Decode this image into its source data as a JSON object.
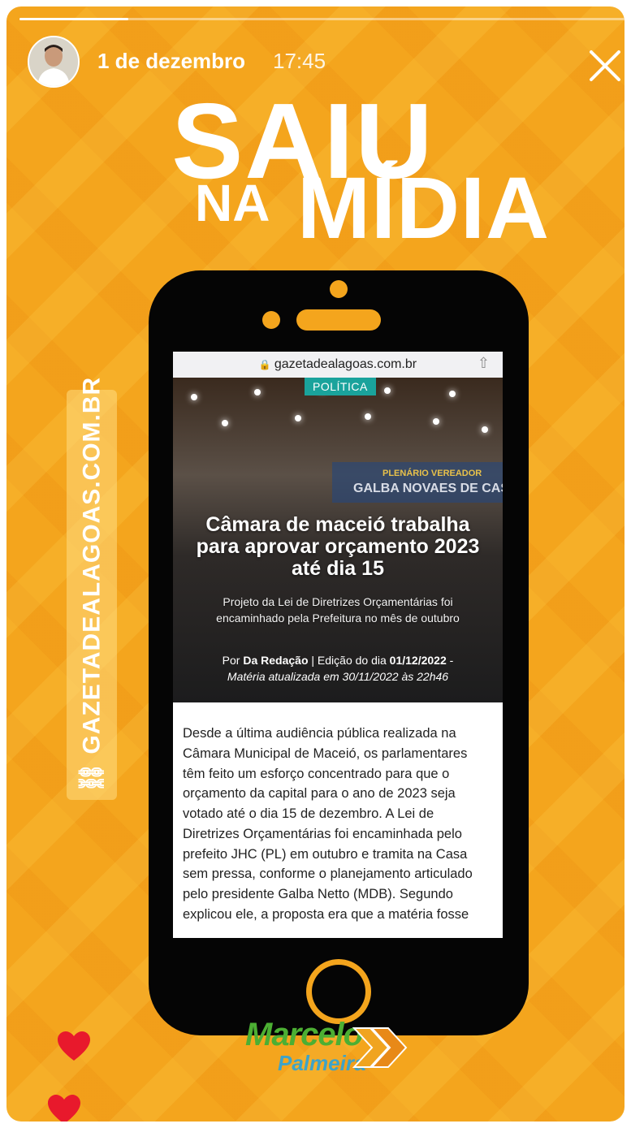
{
  "story": {
    "progress": 0.18,
    "date": "1 de dezembro",
    "time": "17:45",
    "close_icon": "close-icon"
  },
  "headline": {
    "line1": "SAIU",
    "line2_small": "NA",
    "line2_big": "MÍDIA"
  },
  "side_tag": {
    "text": "GAZETADEALAGOAS.COM.BR",
    "icon": "link-icon"
  },
  "browser": {
    "url": "gazetadealagoas.com.br",
    "lock_icon": "lock-icon",
    "share_icon": "share-icon"
  },
  "article": {
    "category": "POLÍTICA",
    "plenario_line1": "PLENÁRIO VEREADOR",
    "plenario_line2": "GALBA NOVAES DE CAST",
    "title": "Câmara de maceió trabalha para aprovar orçamento 2023 até dia 15",
    "subtitle": "Projeto da Lei de Diretrizes Orçamentárias foi encaminhado pela Prefeitura no mês de outubro",
    "byline_prefix": "Por",
    "author": "Da Redação",
    "edition_prefix": "| Edição do dia",
    "edition_date": "01/12/2022",
    "edition_suffix": "-",
    "updated": "Matéria atualizada em 30/11/2022 às 22h46",
    "body": "Desde a última audiência pública realizada na Câmara Municipal de Maceió, os parlamentares têm feito um esforço concentrado para que o orçamento da capital para o ano de 2023 seja votado até o dia 15 de dezembro. A Lei de Diretrizes Orçamentárias foi encaminhada pelo prefeito JHC (PL) em outubro e tramita na Casa sem pressa, conforme o planejamento articulado pelo presidente Galba Netto (MDB). Segundo explicou ele, a proposta era que a matéria fosse"
  },
  "brand": {
    "name": "Marcelo",
    "surname": "Palmeira"
  },
  "colors": {
    "background": "#f4a51d",
    "phone": "#050505",
    "badge": "#1aa39c",
    "heart": "#e8192c",
    "brand_green": "#4caf33",
    "brand_blue": "#3ea3c8"
  }
}
